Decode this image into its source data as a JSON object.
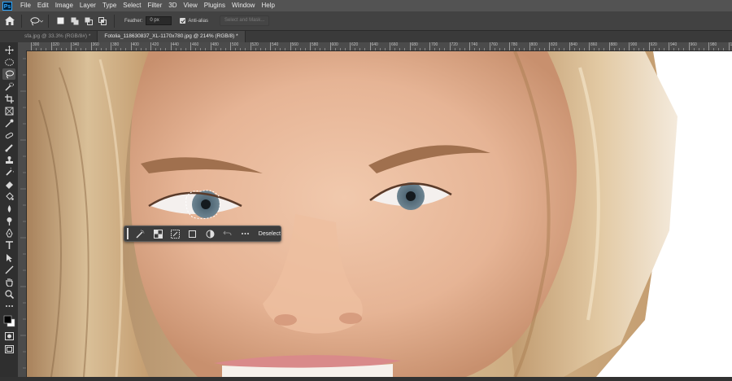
{
  "app": {
    "logo": "Ps"
  },
  "menu": [
    "File",
    "Edit",
    "Image",
    "Layer",
    "Type",
    "Select",
    "Filter",
    "3D",
    "View",
    "Plugins",
    "Window",
    "Help"
  ],
  "options": {
    "feather_label": "Feather:",
    "feather_value": "0 px",
    "antialias_label": "Anti-alias",
    "antialias_checked": true,
    "select_subject_label": "Select and Mask..."
  },
  "tabs": [
    {
      "label": "sfa.jpg @ 33.3% (RGB/8#) *",
      "active": false
    },
    {
      "label": "Fotolia_118630837_XL-1170x780.jpg @ 214% (RGB/8) *",
      "active": true
    }
  ],
  "ruler_ticks": [
    "300",
    "320",
    "340",
    "360",
    "380",
    "400",
    "420",
    "440",
    "460",
    "480",
    "500",
    "520",
    "540",
    "560",
    "580",
    "600",
    "620",
    "640",
    "660",
    "680",
    "700",
    "720",
    "740",
    "760",
    "780",
    "800",
    "820",
    "840",
    "860",
    "880",
    "900",
    "920",
    "940",
    "960",
    "980",
    "1000"
  ],
  "contextual_taskbar": {
    "deselect_label": "Deselect"
  },
  "colors": {
    "accent": "#31a8ff",
    "foreground": "#000000",
    "background": "#ffffff"
  }
}
